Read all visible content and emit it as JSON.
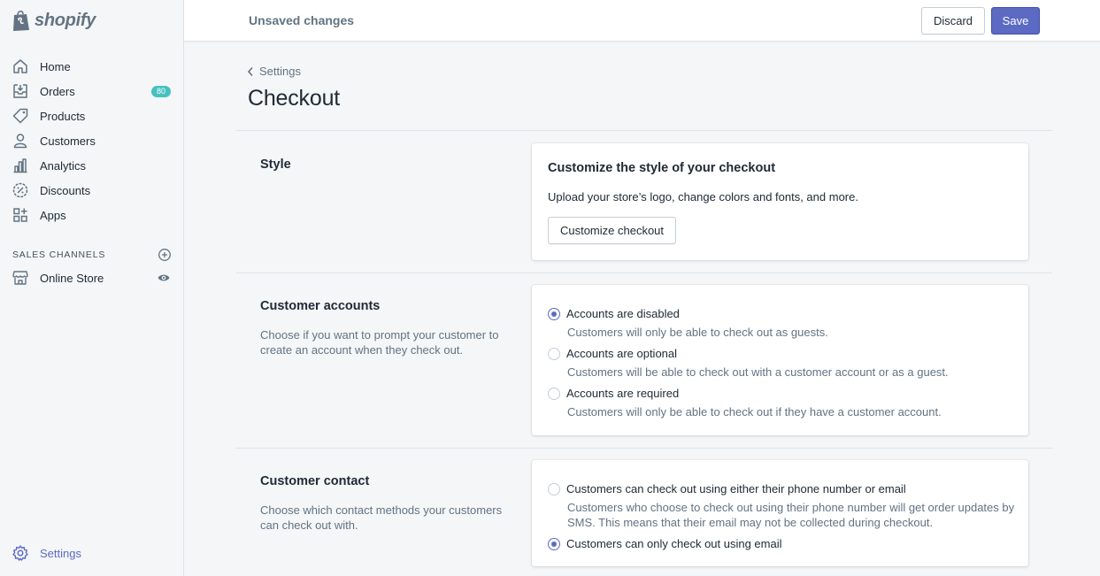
{
  "brand": {
    "name": "shopify"
  },
  "sidebar": {
    "items": [
      {
        "label": "Home",
        "icon": "home-icon"
      },
      {
        "label": "Orders",
        "icon": "orders-icon",
        "badge": "80"
      },
      {
        "label": "Products",
        "icon": "tag-icon"
      },
      {
        "label": "Customers",
        "icon": "person-icon"
      },
      {
        "label": "Analytics",
        "icon": "bar-chart-icon"
      },
      {
        "label": "Discounts",
        "icon": "discount-icon"
      },
      {
        "label": "Apps",
        "icon": "apps-icon"
      }
    ],
    "channels_heading": "SALES CHANNELS",
    "online_store": "Online Store",
    "settings": "Settings"
  },
  "topbar": {
    "status": "Unsaved changes",
    "discard_label": "Discard",
    "save_label": "Save"
  },
  "page": {
    "breadcrumb": "Settings",
    "title": "Checkout"
  },
  "style_section": {
    "title": "Style",
    "card_title": "Customize the style of your checkout",
    "card_text": "Upload your store’s logo, change colors and fonts, and more.",
    "button_label": "Customize checkout"
  },
  "accounts_section": {
    "title": "Customer accounts",
    "description": "Choose if you want to prompt your customer to create an account when they check out.",
    "options": [
      {
        "label": "Accounts are disabled",
        "help": "Customers will only be able to check out as guests.",
        "checked": true
      },
      {
        "label": "Accounts are optional",
        "help": "Customers will be able to check out with a customer account or as a guest.",
        "checked": false
      },
      {
        "label": "Accounts are required",
        "help": "Customers will only be able to check out if they have a customer account.",
        "checked": false
      }
    ]
  },
  "contact_section": {
    "title": "Customer contact",
    "description": "Choose which contact methods your customers can check out with.",
    "options": [
      {
        "label": "Customers can check out using either their phone number or email",
        "help": "Customers who choose to check out using their phone number will get order updates by SMS. This means that their email may not be collected during checkout.",
        "checked": false
      },
      {
        "label": "Customers can only check out using email",
        "checked": true
      }
    ]
  },
  "colors": {
    "accent": "#5c6ac4",
    "badge": "#47c1bf",
    "background": "#f4f6f8"
  }
}
